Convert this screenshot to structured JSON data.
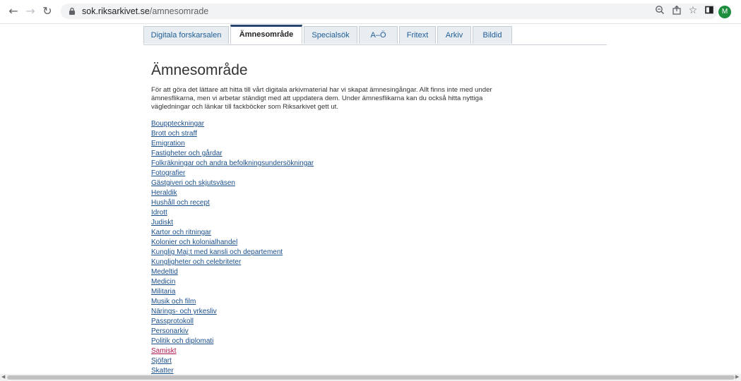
{
  "browser": {
    "url_host": "sok.riksarkivet.se",
    "url_path": "/amnesomrade",
    "avatar_letter": "M"
  },
  "tabs": [
    {
      "label": "Digitala forskarsalen",
      "active": false
    },
    {
      "label": "Ämnesområde",
      "active": true
    },
    {
      "label": "Specialsök",
      "active": false
    },
    {
      "label": "A–Ö",
      "active": false
    },
    {
      "label": "Fritext",
      "active": false
    },
    {
      "label": "Arkiv",
      "active": false
    },
    {
      "label": "Bildid",
      "active": false
    }
  ],
  "page": {
    "title": "Ämnesområde",
    "intro": "För att göra det lättare att hitta till vårt digitala arkivmaterial har vi skapat ämnesingångar. Allt finns inte med under ämnesflikarna, men vi arbetar ständigt med att uppdatera dem. Under ämnesflikarna kan du också hitta nyttiga vägledningar och länkar till fackböcker som Riksarkivet gett ut."
  },
  "topics": [
    {
      "label": "Bouppteckningar",
      "visited": false
    },
    {
      "label": "Brott och straff",
      "visited": false
    },
    {
      "label": "Emigration",
      "visited": false
    },
    {
      "label": "Fastigheter och gårdar",
      "visited": false
    },
    {
      "label": "Folkräkningar och andra befolkningsundersökningar",
      "visited": false
    },
    {
      "label": "Fotografier",
      "visited": false
    },
    {
      "label": "Gästgiveri och skjutsväsen",
      "visited": false
    },
    {
      "label": "Heraldik",
      "visited": false
    },
    {
      "label": "Hushåll och recept",
      "visited": false
    },
    {
      "label": "Idrott",
      "visited": false
    },
    {
      "label": "Judiskt",
      "visited": false
    },
    {
      "label": "Kartor och ritningar",
      "visited": false
    },
    {
      "label": "Kolonier och kolonialhandel",
      "visited": false
    },
    {
      "label": "Kunglig Maj:t med kansli och departement",
      "visited": false
    },
    {
      "label": "Kungligheter och celebriteter",
      "visited": false
    },
    {
      "label": "Medeltid",
      "visited": false
    },
    {
      "label": "Medicin",
      "visited": false
    },
    {
      "label": "Militaria",
      "visited": false
    },
    {
      "label": "Musik och film",
      "visited": false
    },
    {
      "label": "Närings- och yrkesliv",
      "visited": false
    },
    {
      "label": "Passprotokoll",
      "visited": false
    },
    {
      "label": "Personarkiv",
      "visited": false
    },
    {
      "label": "Politik och diplomati",
      "visited": false
    },
    {
      "label": "Samiskt",
      "visited": true
    },
    {
      "label": "Sjöfart",
      "visited": false
    },
    {
      "label": "Skatter",
      "visited": false
    }
  ],
  "colors": {
    "link": "#1a4f8a",
    "visited_link": "#b0174f",
    "active_tab_border": "#27476f",
    "avatar_bg": "#1e8e3e"
  }
}
